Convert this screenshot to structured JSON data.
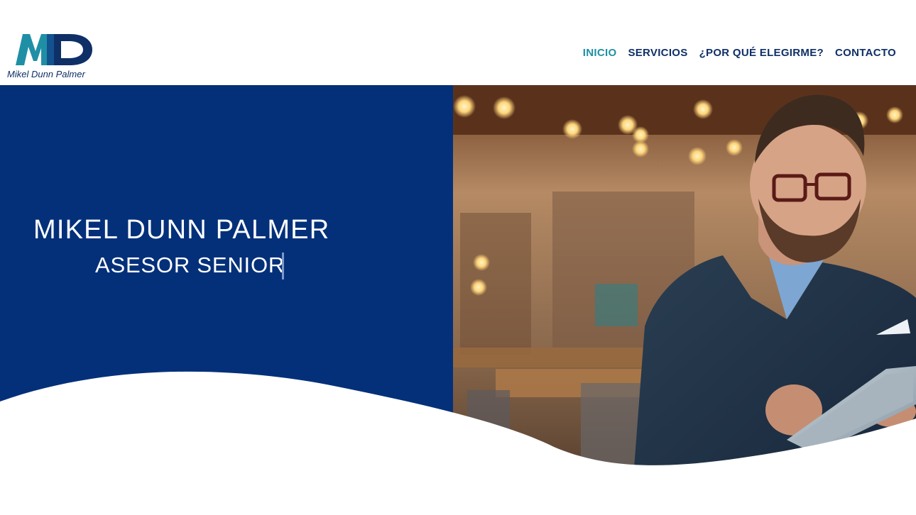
{
  "brand": {
    "logo_letters": "MD",
    "name": "Mikel Dunn Palmer",
    "colors": {
      "teal": "#1f8fa6",
      "navy": "#0f2f67"
    }
  },
  "nav": {
    "items": [
      {
        "label": "INICIO",
        "active": true
      },
      {
        "label": "SERVICIOS",
        "active": false
      },
      {
        "label": "¿POR QUÉ ELEGIRME?",
        "active": false
      },
      {
        "label": "CONTACTO",
        "active": false
      }
    ]
  },
  "hero": {
    "title": "MIKEL DUNN PALMER",
    "subtitle": "ASESOR SENIOR",
    "background_color": "#04307a",
    "photo_description_icon": "businessman-with-tablet-photo"
  }
}
